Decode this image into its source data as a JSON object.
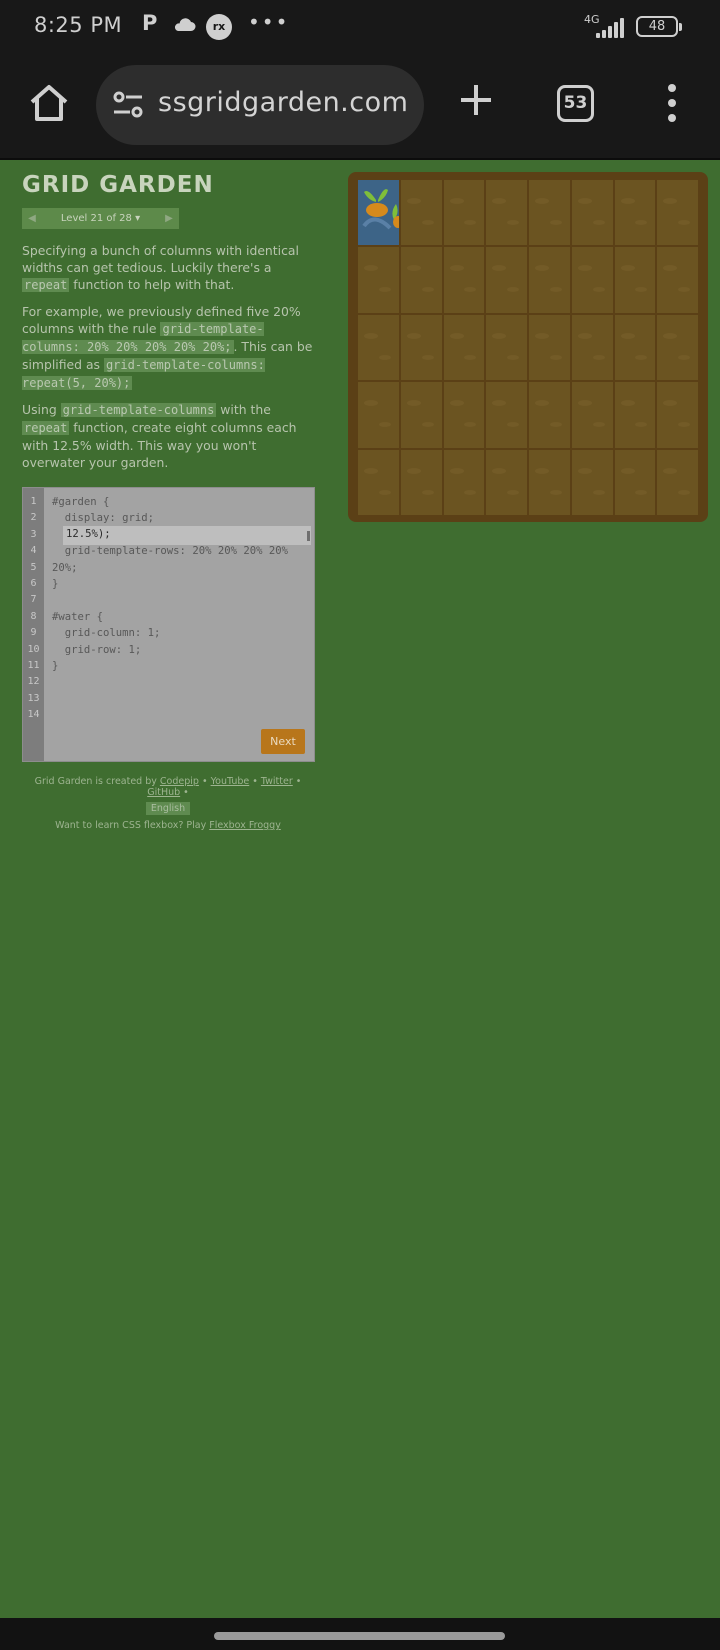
{
  "status_bar": {
    "time": "8:25 PM",
    "network": "4G",
    "battery": "48",
    "icons": [
      "p-icon",
      "cloud-icon",
      "badge-icon",
      "more-dots-icon",
      "signal-icon",
      "battery-icon"
    ]
  },
  "browser": {
    "url": "ssgridgarden.com",
    "tab_count": "53"
  },
  "page": {
    "title": "GRID GARDEN",
    "level": "Level 21 of 28 ▾",
    "instructions": {
      "p1_a": "Specifying a bunch of columns with identical widths can get tedious. Luckily there's a ",
      "p1_code": "repeat",
      "p1_b": " function to help with that.",
      "p2_a": "For example, we previously defined five 20% columns with the rule ",
      "p2_code1": "grid-template-columns: 20% 20% 20% 20% 20%;",
      "p2_b": ". This can be simplified as ",
      "p2_code2": "grid-template-columns: repeat(5, 20%);",
      "p3_a": "Using ",
      "p3_code1": "grid-template-columns",
      "p3_b": " with the ",
      "p3_code2": "repeat",
      "p3_c": " function, create eight columns each with 12.5% width. This way you won't overwater your garden."
    },
    "editor": {
      "line_numbers": [
        "1",
        "2",
        "3",
        "4",
        "5",
        "6",
        "7",
        "8",
        "9",
        "10",
        "11",
        "12",
        "13",
        "14"
      ],
      "line1": "#garden {",
      "line2": "  display: grid;",
      "input_value": "12.5%);",
      "line4": "  grid-template-rows: 20% 20% 20% 20%",
      "line5": "20%;",
      "line6": "}",
      "line8": "#water {",
      "line9": "  grid-column: 1;",
      "line10": "  grid-row: 1;",
      "line11": "}",
      "next_label": "Next"
    },
    "footer": {
      "created_by": "Grid Garden is created by ",
      "codepip": "Codepip",
      "youtube": "YouTube",
      "twitter": "Twitter",
      "github": "GitHub",
      "sep": " • ",
      "language": "English",
      "froggy_text": "Want to learn CSS flexbox? Play ",
      "froggy_link": "Flexbox Froggy"
    },
    "garden": {
      "columns": 8,
      "rows": 5,
      "water_cell": {
        "column": 1,
        "row": 1
      }
    }
  }
}
